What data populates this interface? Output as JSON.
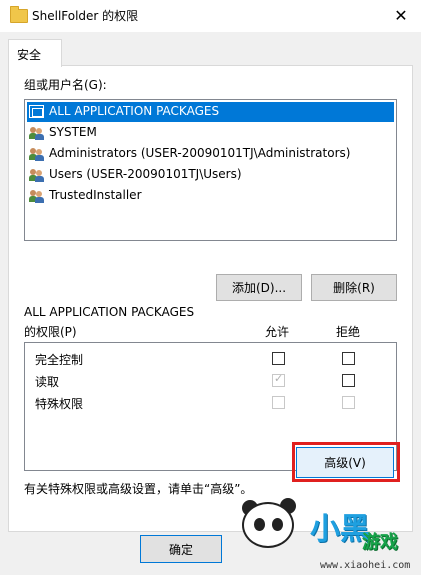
{
  "window": {
    "title": "ShellFolder 的权限"
  },
  "tab": {
    "label": "安全"
  },
  "groups": {
    "label": "组或用户名(G):",
    "items": [
      {
        "label": "ALL APPLICATION PACKAGES",
        "icon": "package-icon",
        "selected": true
      },
      {
        "label": "SYSTEM",
        "icon": "users-icon"
      },
      {
        "label": "Administrators (USER-20090101TJ\\Administrators)",
        "icon": "users-icon"
      },
      {
        "label": "Users (USER-20090101TJ\\Users)",
        "icon": "users-icon"
      },
      {
        "label": "TrustedInstaller",
        "icon": "users-icon"
      }
    ]
  },
  "buttons": {
    "add": "添加(D)...",
    "remove": "删除(R)",
    "advanced": "高级(V)",
    "ok": "确定"
  },
  "permissions": {
    "heading_line1": "ALL APPLICATION PACKAGES",
    "heading_line2": "的权限(P)",
    "allow_header": "允许",
    "deny_header": "拒绝",
    "rows": [
      {
        "name": "完全控制",
        "allow": false,
        "deny": false,
        "allow_disabled": false,
        "deny_disabled": false
      },
      {
        "name": "读取",
        "allow": true,
        "deny": false,
        "allow_disabled": true,
        "deny_disabled": false
      },
      {
        "name": "特殊权限",
        "allow": false,
        "deny": false,
        "allow_disabled": true,
        "deny_disabled": true
      }
    ]
  },
  "advanced_note": "有关特殊权限或高级设置，请单击“高级”。",
  "watermark": {
    "text1": "小黑",
    "text2": "游戏",
    "url": "www.xiaohei.com"
  },
  "colors": {
    "selection": "#0078d7",
    "highlight_border": "#e0201f",
    "watermark_blue": "#1fa0e0"
  }
}
